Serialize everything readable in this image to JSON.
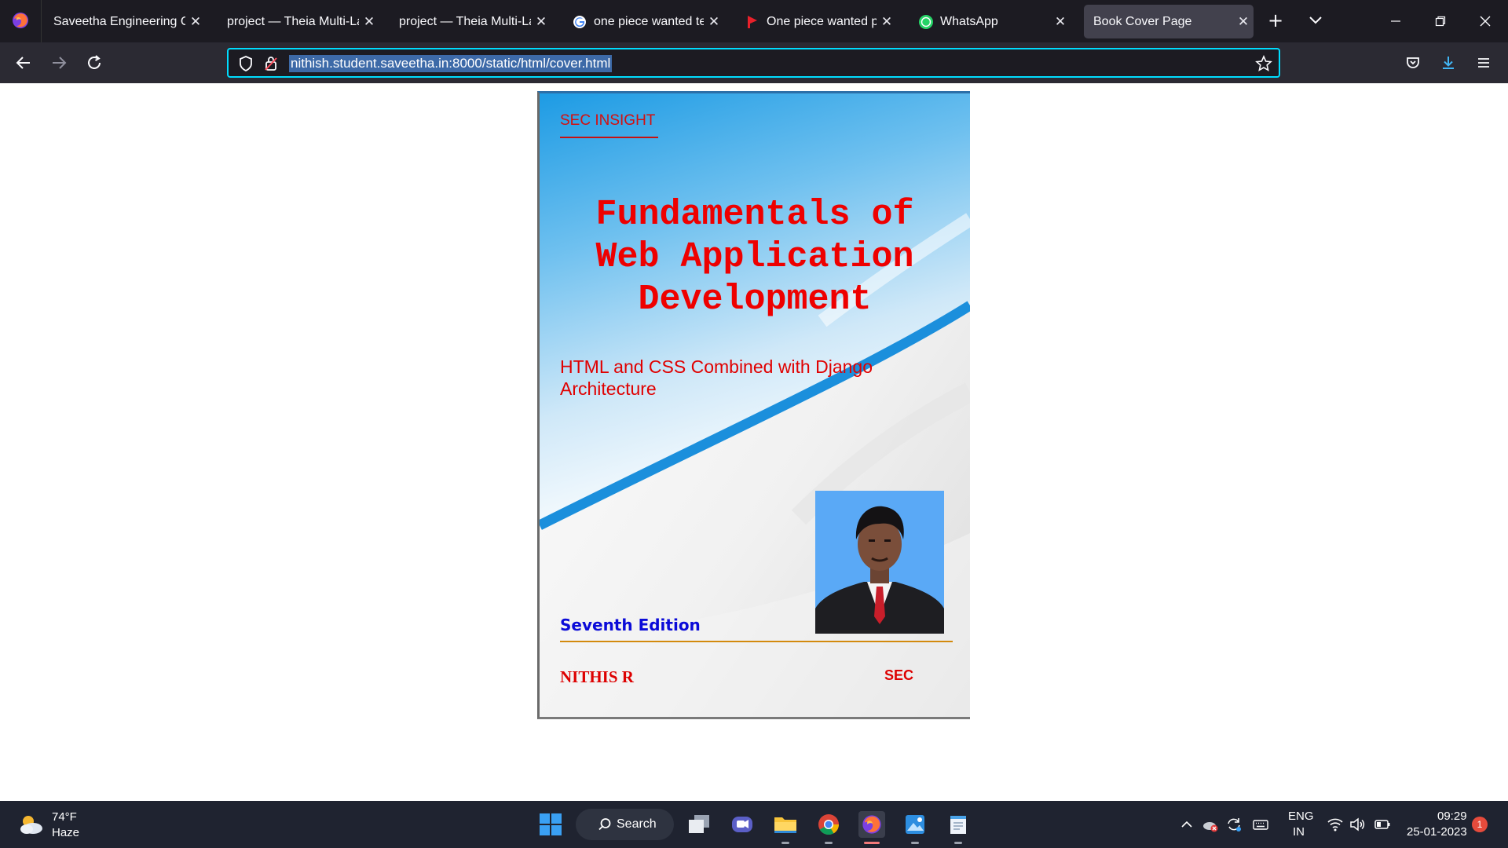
{
  "browser": {
    "tabs": [
      {
        "title": "Saveetha Engineering College",
        "favicon": "none"
      },
      {
        "title": "project — Theia Multi-Language Workspace",
        "favicon": "none"
      },
      {
        "title": "project — Theia Multi-Language Workspace",
        "favicon": "none"
      },
      {
        "title": "one piece wanted template - Google Search",
        "favicon": "google-icon"
      },
      {
        "title": "One piece wanted poster maker",
        "favicon": "red-flag-icon"
      },
      {
        "title": "WhatsApp",
        "favicon": "whatsapp-icon"
      },
      {
        "title": "Book Cover Page",
        "favicon": "none",
        "active": true
      }
    ],
    "close_glyph": "✕",
    "new_tab_glyph": "+",
    "url": "nithish.student.saveetha.in:8000/static/html/cover.html"
  },
  "cover": {
    "brand": "SEC INSIGHT",
    "title_lines": [
      "Fundamentals of",
      "Web Application",
      "Development"
    ],
    "subtitle_lines": [
      "HTML and CSS Combined with Django",
      "Architecture"
    ],
    "edition": "Seventh Edition",
    "author": "NITHIS R",
    "publisher": "SEC",
    "colors": {
      "title": "#ee0000",
      "edition": "#0b0bd8",
      "accent_line": "#d38a0d",
      "swoosh": "#1f8fd8"
    }
  },
  "taskbar": {
    "weather_temp": "74°F",
    "weather_desc": "Haze",
    "search_label": "Search",
    "apps": [
      "task-view-icon",
      "teams-icon",
      "file-explorer-icon",
      "chrome-icon",
      "firefox-icon",
      "photos-icon",
      "notepad-icon"
    ],
    "language_top": "ENG",
    "language_bottom": "IN",
    "time": "09:29",
    "date": "25-01-2023",
    "notification_count": "1"
  }
}
